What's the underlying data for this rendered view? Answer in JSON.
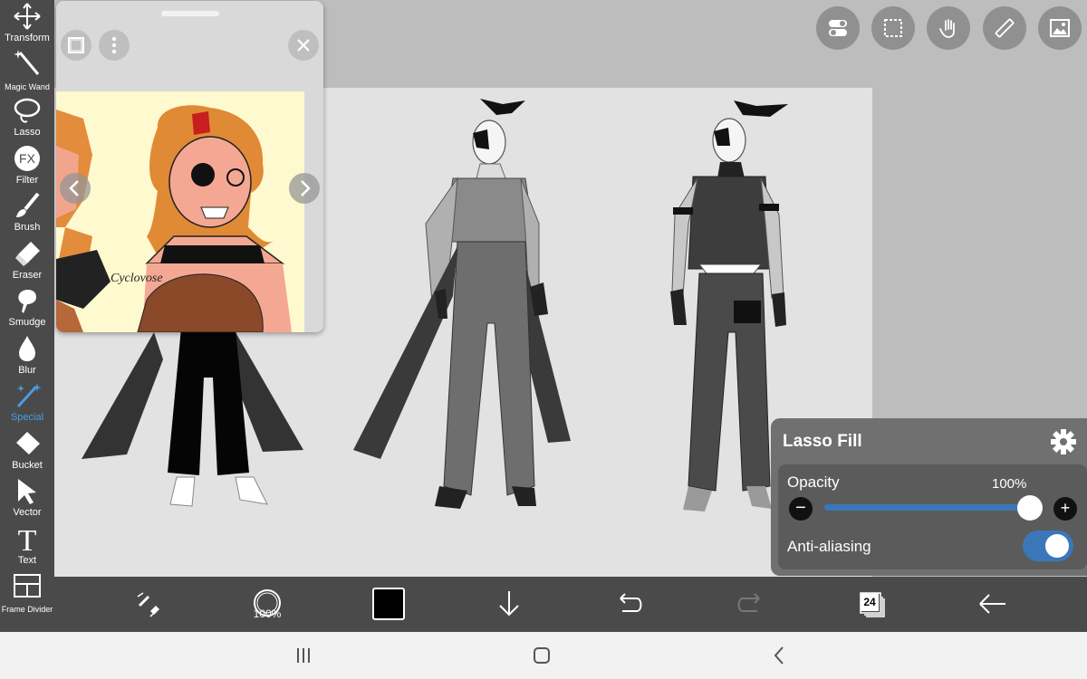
{
  "toolbar": {
    "tools": [
      {
        "label": "Transform",
        "icon": "move-arrows-icon"
      },
      {
        "label": "Magic Wand",
        "icon": "magic-wand-icon"
      },
      {
        "label": "Lasso",
        "icon": "lasso-icon"
      },
      {
        "label": "Filter",
        "icon": "fx-icon",
        "glyph": "FX"
      },
      {
        "label": "Brush",
        "icon": "brush-icon"
      },
      {
        "label": "Eraser",
        "icon": "eraser-icon"
      },
      {
        "label": "Smudge",
        "icon": "smudge-icon"
      },
      {
        "label": "Blur",
        "icon": "drop-icon"
      },
      {
        "label": "Special",
        "icon": "sparkle-wand-icon"
      },
      {
        "label": "Bucket",
        "icon": "bucket-icon"
      },
      {
        "label": "Vector",
        "icon": "cursor-arrow-icon"
      },
      {
        "label": "Text",
        "icon": "text-t-icon",
        "glyph": "T"
      },
      {
        "label": "Frame Divider",
        "icon": "frame-divider-icon"
      }
    ],
    "active_tool": "Special",
    "active_color": "#4d9be6"
  },
  "reference_window": {
    "signature_text": "Cyclovose",
    "background_color": "#fff9cf"
  },
  "top_actions": [
    {
      "icon": "toggle-switches-icon"
    },
    {
      "icon": "selection-marquee-icon"
    },
    {
      "icon": "hand-touch-icon"
    },
    {
      "icon": "ruler-icon"
    },
    {
      "icon": "image-material-icon"
    }
  ],
  "lasso_fill": {
    "title": "Lasso Fill",
    "opacity_label": "Opacity",
    "opacity_value": "100%",
    "opacity_level": 1.0,
    "minus": "−",
    "plus": "+",
    "antialias_label": "Anti-aliasing",
    "antialias_on": true,
    "accent": "#3b77b8"
  },
  "bottom_bar": {
    "brush_size_label": "100%",
    "current_color": "#000000",
    "layer_count": "24"
  },
  "nav": [
    "recent-apps-icon",
    "home-icon",
    "back-icon"
  ]
}
